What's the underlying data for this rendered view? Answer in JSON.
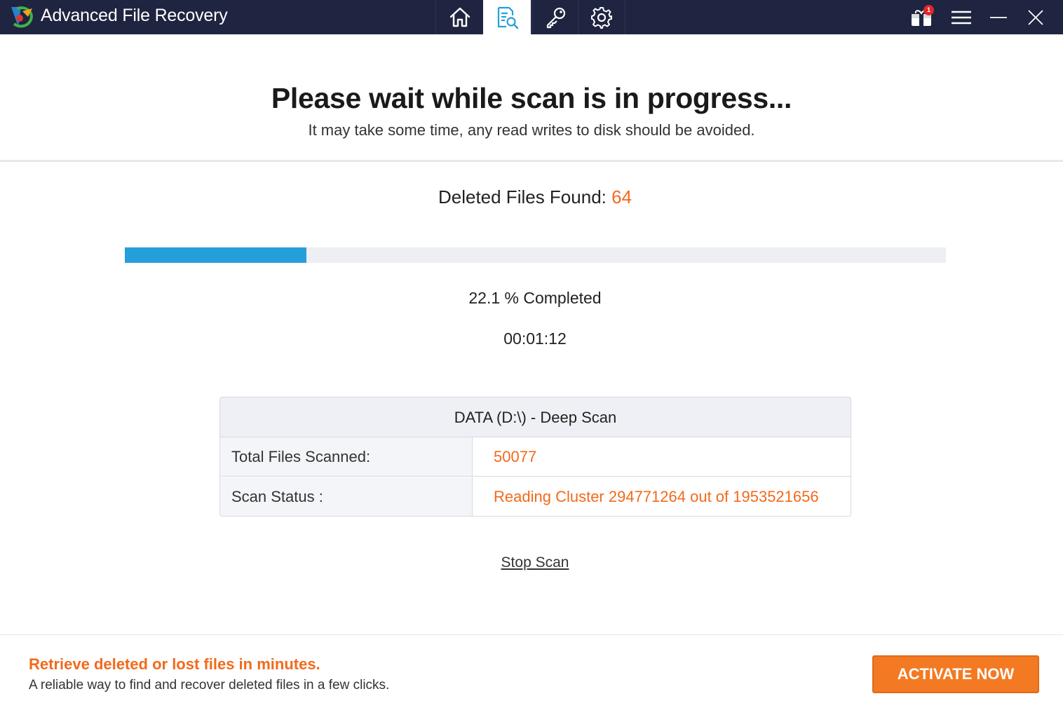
{
  "app": {
    "title": "Advanced File Recovery",
    "logo_icon": "app-logo-icon"
  },
  "nav_tabs": [
    {
      "name": "home",
      "icon": "home-icon",
      "active": false
    },
    {
      "name": "scan",
      "icon": "scan-document-icon",
      "active": true
    },
    {
      "name": "register",
      "icon": "key-icon",
      "active": false
    },
    {
      "name": "settings",
      "icon": "gear-icon",
      "active": false
    }
  ],
  "window_controls": {
    "gift_badge": "1",
    "icons": [
      "gift-icon",
      "hamburger-menu-icon",
      "minimize-icon",
      "close-icon"
    ]
  },
  "header": {
    "title": "Please wait while scan is in progress...",
    "subtitle": "It may take some time, any read writes to disk should be avoided."
  },
  "scan": {
    "found_label": "Deleted Files Found:",
    "found_count": "64",
    "progress_percent": 22.1,
    "percent_text": "22.1 % Completed",
    "elapsed": "00:01:12",
    "table_title": "DATA (D:\\) - Deep Scan",
    "rows": [
      {
        "label": "Total Files Scanned:",
        "value": "50077"
      },
      {
        "label": "Scan Status :",
        "value": "Reading Cluster 294771264 out of 1953521656"
      }
    ],
    "stop_label": "Stop Scan"
  },
  "footer": {
    "promo_title": "Retrieve deleted or lost files in minutes.",
    "promo_subtitle": "A reliable way to find and recover deleted files in a few clicks.",
    "activate_label": "ACTIVATE NOW"
  },
  "colors": {
    "titlebar": "#1f2440",
    "accent_orange": "#f26a1b",
    "progress_blue": "#259fdb",
    "progress_track": "#eeeff3"
  }
}
